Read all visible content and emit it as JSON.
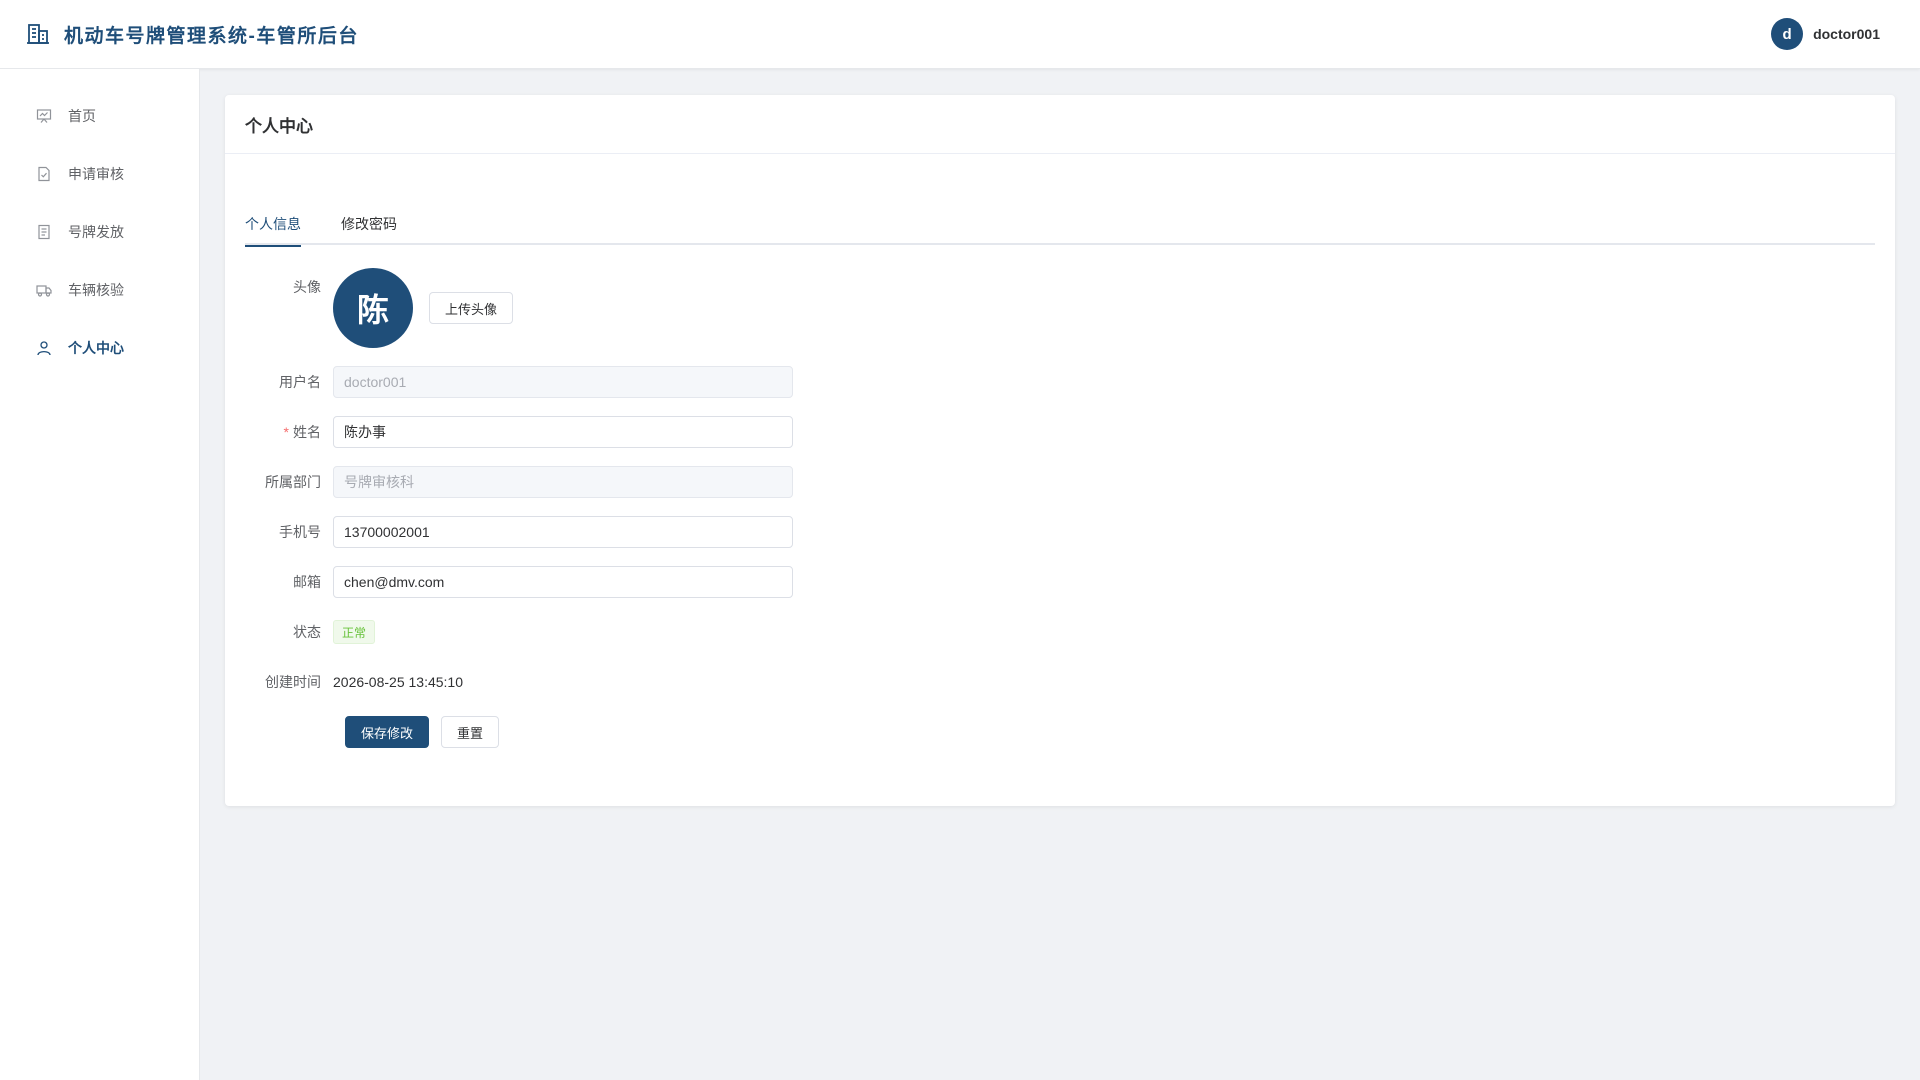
{
  "header": {
    "title": "机动车号牌管理系统-车管所后台",
    "user_initial": "d",
    "username": "doctor001",
    "brand_icon": "building-icon"
  },
  "sidebar": {
    "items": [
      {
        "label": "首页",
        "icon": "dashboard-icon",
        "active": false
      },
      {
        "label": "申请审核",
        "icon": "document-check-icon",
        "active": false
      },
      {
        "label": "号牌发放",
        "icon": "document-list-icon",
        "active": false
      },
      {
        "label": "车辆核验",
        "icon": "truck-icon",
        "active": false
      },
      {
        "label": "个人中心",
        "icon": "user-icon",
        "active": true
      }
    ]
  },
  "card": {
    "title": "个人中心",
    "tabs": [
      {
        "label": "个人信息",
        "active": true
      },
      {
        "label": "修改密码",
        "active": false
      }
    ]
  },
  "form": {
    "avatar_label": "头像",
    "avatar_char": "陈",
    "upload_label": "上传头像",
    "username_label": "用户名",
    "username_value": "doctor001",
    "name_label": "姓名",
    "name_required_mark": "*",
    "name_value": "陈办事",
    "dept_label": "所属部门",
    "dept_value": "号牌审核科",
    "phone_label": "手机号",
    "phone_value": "13700002001",
    "email_label": "邮箱",
    "email_value": "chen@dmv.com",
    "status_label": "状态",
    "status_value": "正常",
    "created_label": "创建时间",
    "created_value": "2026-08-25 13:45:10",
    "save_label": "保存修改",
    "reset_label": "重置"
  },
  "colors": {
    "brand": "#1f4e79",
    "background": "#f0f2f5",
    "success": "#67c23a",
    "required": "#f56c6c"
  }
}
